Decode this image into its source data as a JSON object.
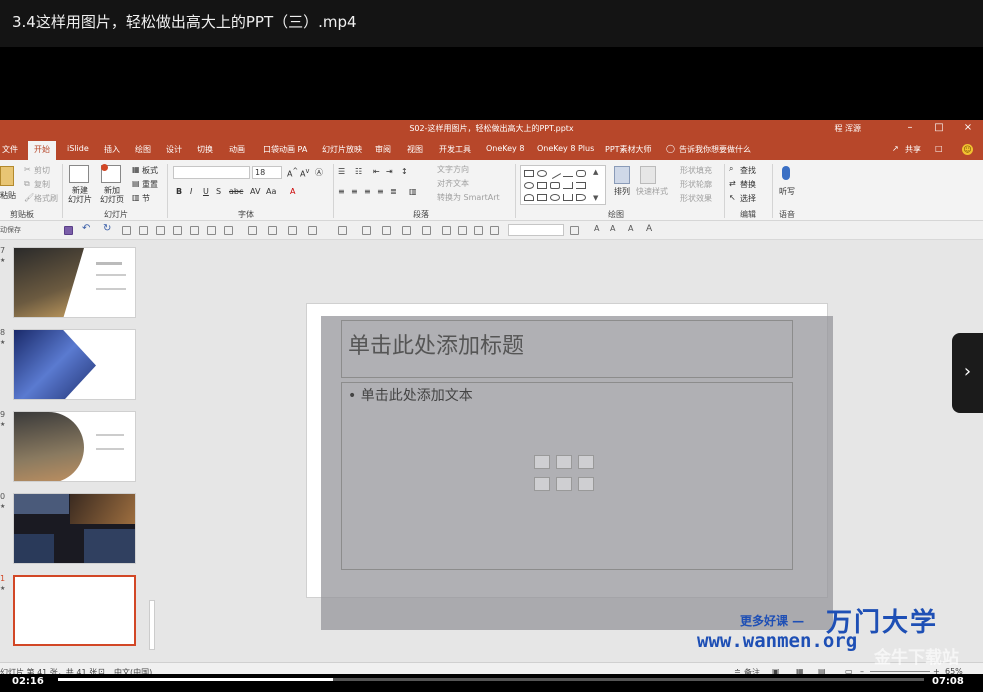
{
  "player": {
    "title": "3.4这样用图片，轻松做出高大上的PPT（三）.mp4",
    "time_current": "02:16",
    "time_total": "07:08",
    "progress_fraction": 0.318,
    "next_glyph": "›"
  },
  "ppt": {
    "document_title": "S02-这样用图片，轻松做出高大上的PPT.pptx",
    "user": "程 浑源",
    "window_buttons": [
      "–",
      "□",
      "×"
    ],
    "tabs": [
      "文件",
      "开始",
      "iSlide",
      "插入",
      "绘图",
      "设计",
      "切换",
      "动画",
      "口袋动画 PA",
      "幻灯片放映",
      "审阅",
      "视图",
      "开发工具",
      "OneKey 8",
      "OneKey 8 Plus",
      "PPT素材大师"
    ],
    "active_tab": "开始",
    "tell_me": "告诉我你想要做什么",
    "share": "共享",
    "ribbon": {
      "clipboard": {
        "paste": "粘贴",
        "cut": "剪切",
        "copy": "复制",
        "format_painter": "格式刷",
        "label": "剪贴板"
      },
      "slides": {
        "new_slide": "新建\n幻灯片",
        "reuse": "新加\n幻灯页",
        "layout": "板式",
        "reset": "重置",
        "section": "节",
        "label": "幻灯片"
      },
      "font": {
        "size": "18",
        "label": "字体"
      },
      "paragraph": {
        "text_direction": "文字方向",
        "align_text": "对齐文本",
        "smartart": "转换为 SmartArt",
        "label": "段落"
      },
      "drawing": {
        "arrange": "排列",
        "quick_styles": "快速样式",
        "fill": "形状填充",
        "outline": "形状轮廓",
        "effects": "形状效果",
        "label": "绘图"
      },
      "editing": {
        "find": "查找",
        "replace": "替换",
        "select": "选择",
        "label": "编辑"
      },
      "voice": {
        "dictate": "听写",
        "label": "语音"
      }
    },
    "qat_label": "动保存",
    "thumbnails": [
      {
        "num": "7",
        "star": "★"
      },
      {
        "num": "8",
        "star": "★"
      },
      {
        "num": "9",
        "star": "★"
      },
      {
        "num": "0",
        "star": "★"
      },
      {
        "num": "1",
        "star": "★"
      }
    ],
    "slide": {
      "title_placeholder": "单击此处添加标题",
      "body_placeholder": "• 单击此处添加文本"
    },
    "status": {
      "slide_info": "幻灯片 第 41 张，共 41 张",
      "language": "中文(中国)",
      "notes": "备注",
      "zoom": "65%"
    }
  },
  "watermark": {
    "tagline": "更多好课 —",
    "brand": "万门大学",
    "url": "www.wanmen.org",
    "site": "金牛下载站"
  },
  "colors": {
    "ppt_accent": "#b7472a",
    "selection": "#d24726",
    "watermark_blue": "#1e4fb5"
  }
}
